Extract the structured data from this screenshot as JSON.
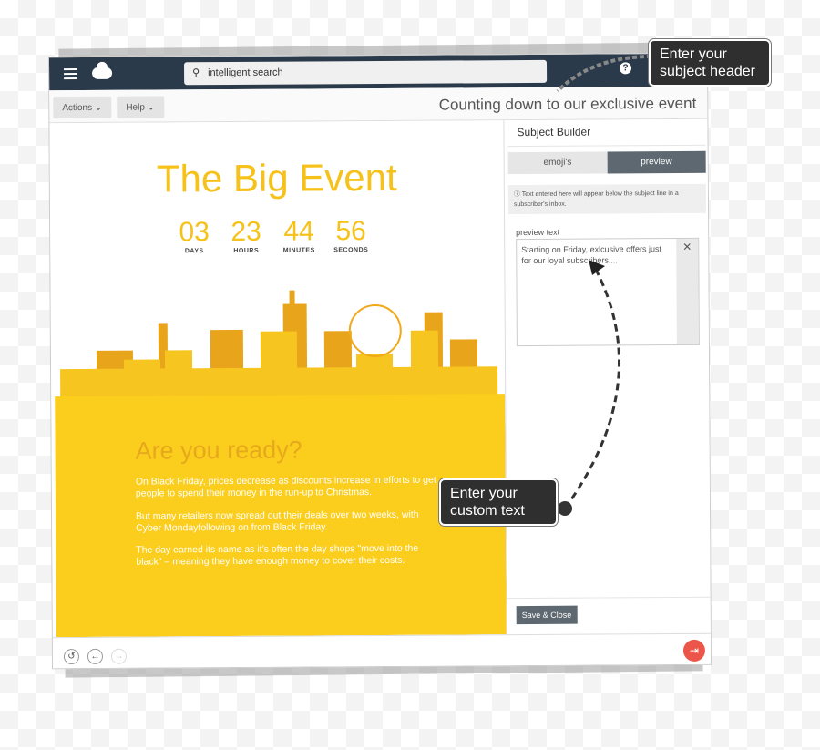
{
  "nav": {
    "search_placeholder": "intelligent search",
    "help": "?"
  },
  "toolbar": {
    "actions": "Actions",
    "help": "Help",
    "subject": "Counting down to our exclusive event"
  },
  "email": {
    "title": "The Big Event",
    "countdown": [
      {
        "value": "03",
        "label": "DAYS"
      },
      {
        "value": "23",
        "label": "HOURS"
      },
      {
        "value": "44",
        "label": "MINUTES"
      },
      {
        "value": "56",
        "label": "SECONDS"
      }
    ],
    "heading": "Are you ready?",
    "paragraphs": [
      "On Black Friday, prices decrease as discounts increase in efforts to get people to spend their money in the run-up to Christmas.",
      "But many retailers now spread out their deals over two weeks, with Cyber Mondayfollowing on from Black Friday.",
      "The day earned its name as it’s often the day shops \"move into the black\" – meaning they have enough money to cover their costs."
    ]
  },
  "panel": {
    "title": "Subject Builder",
    "tabs": [
      "emoji's",
      "preview"
    ],
    "active_tab": "preview",
    "info": "Text entered here will appear below the subject line in a subscriber's inbox.",
    "preview_label": "preview text",
    "preview_value": "Starting on Friday, exlcusive offers just for our loyal subscribers....",
    "save": "Save & Close"
  },
  "callouts": {
    "header": "Enter your subject header",
    "custom": "Enter your custom text"
  },
  "colors": {
    "nav": "#2b3a4a",
    "accent": "#f6c21a",
    "banner": "#fbcd1c",
    "exit": "#ec5549"
  }
}
